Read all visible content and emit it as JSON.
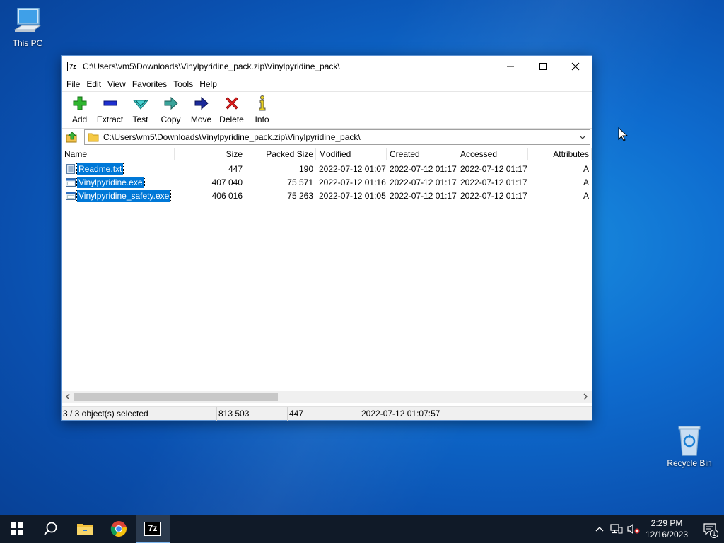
{
  "desktop": {
    "this_pc": "This PC",
    "recycle_bin": "Recycle Bin"
  },
  "window": {
    "title": "C:\\Users\\vm5\\Downloads\\Vinylpyridine_pack.zip\\Vinylpyridine_pack\\",
    "app_icon": "7z"
  },
  "menu": [
    "File",
    "Edit",
    "View",
    "Favorites",
    "Tools",
    "Help"
  ],
  "toolbar": {
    "add": "Add",
    "extract": "Extract",
    "test": "Test",
    "copy": "Copy",
    "move": "Move",
    "delete": "Delete",
    "info": "Info"
  },
  "address": {
    "path": "C:\\Users\\vm5\\Downloads\\Vinylpyridine_pack.zip\\Vinylpyridine_pack\\"
  },
  "columns": [
    "Name",
    "Size",
    "Packed Size",
    "Modified",
    "Created",
    "Accessed",
    "Attributes"
  ],
  "files": [
    {
      "name": "Readme.txt",
      "size": "447",
      "packed": "190",
      "modified": "2022-07-12 01:07",
      "created": "2022-07-12 01:17",
      "accessed": "2022-07-12 01:17",
      "attr": "A",
      "icon": "text-file-icon"
    },
    {
      "name": "Vinylpyridine.exe",
      "size": "407 040",
      "packed": "75 571",
      "modified": "2022-07-12 01:16",
      "created": "2022-07-12 01:17",
      "accessed": "2022-07-12 01:17",
      "attr": "A",
      "icon": "exe-file-icon"
    },
    {
      "name": "Vinylpyridine_safety.exe",
      "size": "406 016",
      "packed": "75 263",
      "modified": "2022-07-12 01:05",
      "created": "2022-07-12 01:17",
      "accessed": "2022-07-12 01:17",
      "attr": "A",
      "icon": "exe-file-icon"
    }
  ],
  "status": {
    "selected": "3 / 3 object(s) selected",
    "total_size": "813 503",
    "packed_size": "447",
    "date": "2022-07-12 01:07:57"
  },
  "taskbar": {
    "time": "2:29 PM",
    "date": "12/16/2023",
    "notification_count": "1",
    "active_app_label": "7z"
  },
  "colors": {
    "selection": "#0078d7",
    "taskbar": "#101a28"
  }
}
